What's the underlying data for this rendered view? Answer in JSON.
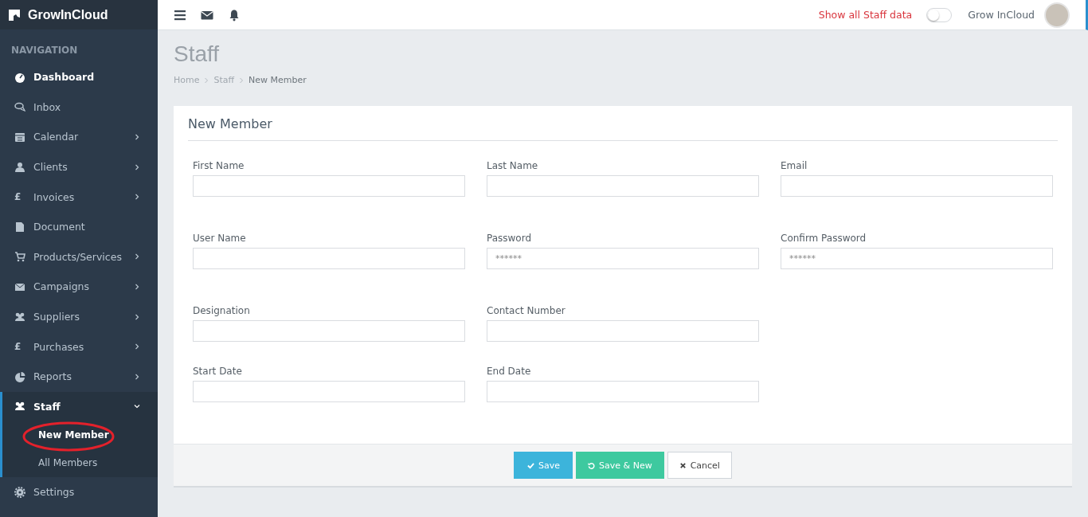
{
  "brand": {
    "name": "GrowInCloud"
  },
  "sidebar": {
    "heading": "NAVIGATION",
    "items": [
      {
        "kind": "dashboard",
        "label": "Dashboard",
        "emphasis": true,
        "selected": false,
        "expandable": false
      },
      {
        "kind": "chat",
        "label": "Inbox",
        "emphasis": false,
        "selected": false,
        "expandable": false
      },
      {
        "kind": "calendar",
        "label": "Calendar",
        "emphasis": false,
        "selected": false,
        "expandable": true,
        "expanded": false
      },
      {
        "kind": "user",
        "label": "Clients",
        "emphasis": false,
        "selected": false,
        "expandable": true,
        "expanded": false
      },
      {
        "kind": "symbol",
        "symbol": "£",
        "label": "Invoices",
        "emphasis": false,
        "selected": false,
        "expandable": true,
        "expanded": false
      },
      {
        "kind": "file",
        "label": "Document",
        "emphasis": false,
        "selected": false,
        "expandable": false
      },
      {
        "kind": "cart",
        "label": "Products/Services",
        "emphasis": false,
        "selected": false,
        "expandable": true,
        "expanded": false
      },
      {
        "kind": "envelope",
        "label": "Campaigns",
        "emphasis": false,
        "selected": false,
        "expandable": true,
        "expanded": false
      },
      {
        "kind": "users",
        "label": "Suppliers",
        "emphasis": false,
        "selected": false,
        "expandable": true,
        "expanded": false
      },
      {
        "kind": "symbol",
        "symbol": "£",
        "label": "Purchases",
        "emphasis": false,
        "selected": false,
        "expandable": true,
        "expanded": false
      },
      {
        "kind": "pie",
        "label": "Reports",
        "emphasis": false,
        "selected": false,
        "expandable": true,
        "expanded": false
      },
      {
        "kind": "users",
        "label": "Staff",
        "emphasis": true,
        "selected": true,
        "expandable": true,
        "expanded": true,
        "children": [
          {
            "label": "New Member",
            "selected": true,
            "circled": true
          },
          {
            "label": "All Members",
            "selected": false,
            "circled": false
          }
        ]
      },
      {
        "kind": "gear",
        "label": "Settings",
        "emphasis": false,
        "selected": false,
        "expandable": false
      }
    ]
  },
  "topbar": {
    "toggle_label": "Show all Staff data",
    "toggle_on": false,
    "user_name": "Grow InCloud"
  },
  "page": {
    "title": "Staff",
    "breadcrumb": [
      "Home",
      "Staff",
      "New Member"
    ]
  },
  "form": {
    "title": "New Member",
    "rows": [
      [
        {
          "label": "First Name"
        },
        {
          "label": "Last Name"
        },
        {
          "label": "Email"
        }
      ],
      [
        {
          "label": "User Name"
        },
        {
          "label": "Password",
          "placeholder": "******"
        },
        {
          "label": "Confirm Password",
          "placeholder": "******"
        }
      ],
      [
        {
          "label": "Designation"
        },
        {
          "label": "Contact Number"
        }
      ],
      [
        {
          "label": "Start Date"
        },
        {
          "label": "End Date"
        }
      ]
    ],
    "buttons": [
      {
        "kind": "primary",
        "label": "Save"
      },
      {
        "kind": "success",
        "label": "Save & New"
      },
      {
        "kind": "cancel",
        "label": "Cancel"
      }
    ]
  }
}
